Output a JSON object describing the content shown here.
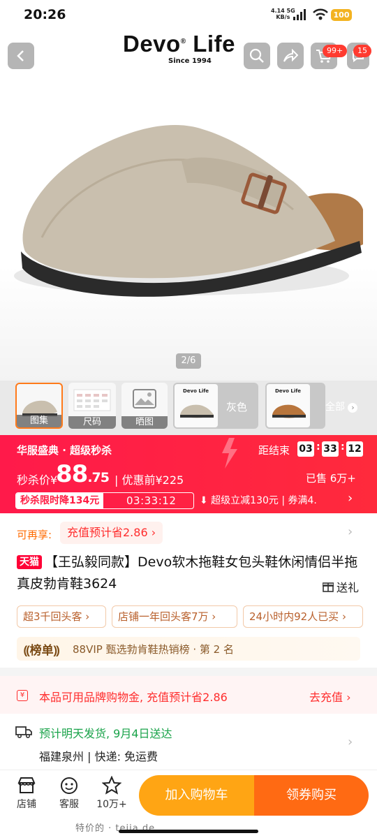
{
  "status_bar": {
    "time": "20:26",
    "net_speed": "4.14",
    "net_unit": "KB/s",
    "net_type": "5G",
    "battery": "100"
  },
  "header": {
    "brand": "Devo",
    "brand_mark": "®",
    "brand_word": "Life",
    "brand_sub": "Since 1994",
    "cart_badge": "99+",
    "msg_badge": "15"
  },
  "gallery": {
    "pager": "2/6",
    "all_label": "全部"
  },
  "thumbs": [
    {
      "label": "图集"
    },
    {
      "label": "尺码"
    },
    {
      "label": "晒图"
    },
    {
      "label": "灰色"
    },
    {
      "label": ""
    }
  ],
  "thumb_brand": "Devo Life",
  "flash_sale": {
    "title": "华服盛典 · 超级秒杀",
    "countdown_label": "距结束",
    "countdown": [
      "03",
      "33",
      "12"
    ],
    "price_label": "秒杀价¥",
    "price_int": "88",
    "price_dec": ".75",
    "prev_price": "| 优惠前¥225",
    "sold": "已售 6万+",
    "limit_label": "秒杀限时降134元",
    "limit_timer": "03:33:12",
    "sub_text": "⬇ 超级立减130元 | 券满4."
  },
  "coupon_row": {
    "label": "可再享:",
    "pill": "充值预计省2.86 ›"
  },
  "product": {
    "store_badge": "天猫",
    "title": "【王弘毅同款】Devo软木拖鞋女包头鞋休闲情侣半拖真皮勃肯鞋3624",
    "gift": "送礼"
  },
  "chips": [
    "超3千回头客 ›",
    "店铺一年回头客7万 ›",
    "24小时内92人已买 ›"
  ],
  "rank": {
    "badge": "榜单",
    "text": "88VIP 甄选勃肯鞋热销榜 · 第 2 名"
  },
  "brand_gold": {
    "icon": "¥",
    "text": "本品可用品牌购物金, 充值预计省2.86",
    "action": "去充值 ›"
  },
  "shipping": {
    "line1": "预计明天发货, 9月4日送达",
    "line2": "福建泉州 | 快递: 免运费"
  },
  "bottom_bar": {
    "shop": "店铺",
    "service": "客服",
    "fav": "10万+",
    "add_cart": "加入购物车",
    "buy": "领券购买",
    "watermark": "特价的 · teija.de"
  },
  "colors": {
    "accent": "#ff1e44",
    "cart": "#ffa514",
    "buy": "#ff6a13",
    "ship": "#1aa34a"
  },
  "icons": [
    "back-icon",
    "search-icon",
    "share-icon",
    "cart-icon",
    "message-icon",
    "gift-icon",
    "shop-icon",
    "service-icon",
    "star-icon",
    "truck-icon",
    "chevron-right-icon"
  ]
}
